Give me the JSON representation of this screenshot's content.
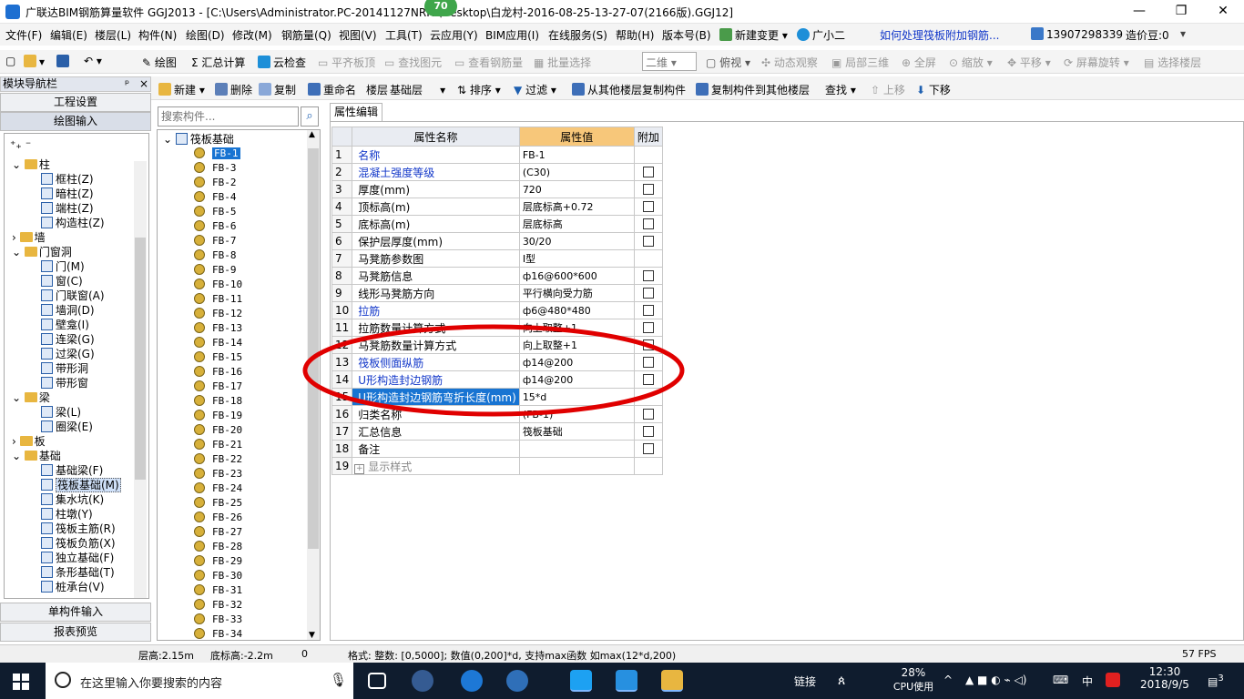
{
  "window": {
    "title": "广联达BIM钢筋算量软件 GGJ2013 - [C:\\Users\\Administrator.PC-20141127NRHI\\Desktop\\白龙村-2016-08-25-13-27-07(2166版).GGJ12]",
    "badge": "70",
    "minimize": "—",
    "restore": "❐",
    "close": "✕"
  },
  "menu": [
    "文件(F)",
    "编辑(E)",
    "楼层(L)",
    "构件(N)",
    "绘图(D)",
    "修改(M)",
    "钢筋量(Q)",
    "视图(V)",
    "工具(T)",
    "云应用(Y)",
    "BIM应用(I)",
    "在线服务(S)",
    "帮助(H)",
    "版本号(B)",
    "新建变更",
    "广小二",
    "如何处理筏板附加钢筋...",
    "13907298339",
    "造价豆:0"
  ],
  "toolbar1": {
    "draw": "绘图",
    "sum": "汇总计算",
    "cloud_check": "云检查",
    "align_board": "平齐板顶",
    "find_elem": "查找图元",
    "view_rebar": "查看钢筋量",
    "batch_select": "批量选择",
    "view_mode": "二维",
    "top_view": "俯视",
    "dyn_view": "动态观察",
    "local_3d": "局部三维",
    "fullscreen": "全屏",
    "zoom": "缩放",
    "pan": "平移",
    "rotate": "屏幕旋转",
    "select_floor": "选择楼层"
  },
  "nav": {
    "header": "模块导航栏",
    "pin": "ᵖ",
    "close": "×",
    "project_settings": "工程设置",
    "draw_input": "绘图输入",
    "single_input": "单构件输入",
    "report_preview": "报表预览",
    "tree": [
      {
        "label": "柱",
        "level": 0,
        "type": "folder",
        "exp": "⌄"
      },
      {
        "label": "框柱(Z)",
        "level": 1
      },
      {
        "label": "暗柱(Z)",
        "level": 1
      },
      {
        "label": "端柱(Z)",
        "level": 1
      },
      {
        "label": "构造柱(Z)",
        "level": 1
      },
      {
        "label": "墙",
        "level": 0,
        "type": "folder",
        "exp": "›"
      },
      {
        "label": "门窗洞",
        "level": 0,
        "type": "folder",
        "exp": "⌄"
      },
      {
        "label": "门(M)",
        "level": 1
      },
      {
        "label": "窗(C)",
        "level": 1
      },
      {
        "label": "门联窗(A)",
        "level": 1
      },
      {
        "label": "墙洞(D)",
        "level": 1
      },
      {
        "label": "壁龛(I)",
        "level": 1
      },
      {
        "label": "连梁(G)",
        "level": 1
      },
      {
        "label": "过梁(G)",
        "level": 1
      },
      {
        "label": "带形洞",
        "level": 1
      },
      {
        "label": "带形窗",
        "level": 1
      },
      {
        "label": "梁",
        "level": 0,
        "type": "folder",
        "exp": "⌄"
      },
      {
        "label": "梁(L)",
        "level": 1
      },
      {
        "label": "圈梁(E)",
        "level": 1
      },
      {
        "label": "板",
        "level": 0,
        "type": "folder",
        "exp": "›"
      },
      {
        "label": "基础",
        "level": 0,
        "type": "folder",
        "exp": "⌄"
      },
      {
        "label": "基础梁(F)",
        "level": 1
      },
      {
        "label": "筏板基础(M)",
        "level": 1,
        "selected": true
      },
      {
        "label": "集水坑(K)",
        "level": 1
      },
      {
        "label": "柱墩(Y)",
        "level": 1
      },
      {
        "label": "筏板主筋(R)",
        "level": 1
      },
      {
        "label": "筏板负筋(X)",
        "level": 1
      },
      {
        "label": "独立基础(F)",
        "level": 1
      },
      {
        "label": "条形基础(T)",
        "level": 1
      },
      {
        "label": "桩承台(V)",
        "level": 1
      }
    ]
  },
  "toolbar2": {
    "new": "新建",
    "delete": "删除",
    "copy": "复制",
    "rename": "重命名",
    "floor_label": "楼层",
    "floor_value": "基础层",
    "sort": "排序",
    "filter": "过滤",
    "copy_from": "从其他楼层复制构件",
    "copy_to": "复制构件到其他楼层",
    "find": "查找",
    "move_up": "上移",
    "move_down": "下移"
  },
  "search": {
    "placeholder": "搜索构件...",
    "icon": "⌕"
  },
  "component_tree": {
    "root": "筏板基础",
    "items": [
      "FB-1",
      "FB-3",
      "FB-2",
      "FB-4",
      "FB-5",
      "FB-6",
      "FB-7",
      "FB-8",
      "FB-9",
      "FB-10",
      "FB-11",
      "FB-12",
      "FB-13",
      "FB-14",
      "FB-15",
      "FB-16",
      "FB-17",
      "FB-18",
      "FB-19",
      "FB-20",
      "FB-21",
      "FB-22",
      "FB-23",
      "FB-24",
      "FB-25",
      "FB-26",
      "FB-27",
      "FB-28",
      "FB-29",
      "FB-30",
      "FB-31",
      "FB-32",
      "FB-33",
      "FB-34"
    ]
  },
  "props": {
    "tab": "属性编辑",
    "headers": [
      "属性名称",
      "属性值",
      "附加"
    ],
    "rows": [
      {
        "n": "1",
        "name": "名称",
        "value": "FB-1",
        "blue": true,
        "cb": false
      },
      {
        "n": "2",
        "name": "混凝土强度等级",
        "value": "(C30)",
        "blue": true,
        "cb": true
      },
      {
        "n": "3",
        "name": "厚度(mm)",
        "value": "720",
        "blue": false,
        "cb": true
      },
      {
        "n": "4",
        "name": "顶标高(m)",
        "value": "层底标高+0.72",
        "blue": false,
        "cb": true
      },
      {
        "n": "5",
        "name": "底标高(m)",
        "value": "层底标高",
        "blue": false,
        "cb": true
      },
      {
        "n": "6",
        "name": "保护层厚度(mm)",
        "value": "30/20",
        "blue": false,
        "cb": true
      },
      {
        "n": "7",
        "name": "马凳筋参数图",
        "value": "Ⅰ型",
        "blue": false,
        "cb": false
      },
      {
        "n": "8",
        "name": "马凳筋信息",
        "value": "ф16@600*600",
        "blue": false,
        "cb": true
      },
      {
        "n": "9",
        "name": "线形马凳筋方向",
        "value": "平行横向受力筋",
        "blue": false,
        "cb": true
      },
      {
        "n": "10",
        "name": "拉筋",
        "value": "ф6@480*480",
        "blue": true,
        "cb": true
      },
      {
        "n": "11",
        "name": "拉筋数量计算方式",
        "value": "向上取整+1",
        "blue": false,
        "cb": true
      },
      {
        "n": "12",
        "name": "马凳筋数量计算方式",
        "value": "向上取整+1",
        "blue": false,
        "cb": true
      },
      {
        "n": "13",
        "name": "筏板侧面纵筋",
        "value": "ф14@200",
        "blue": true,
        "cb": true
      },
      {
        "n": "14",
        "name": "U形构造封边钢筋",
        "value": "ф14@200",
        "blue": true,
        "cb": true
      },
      {
        "n": "15",
        "name": "U形构造封边钢筋弯折长度(mm)",
        "value": "15*d",
        "blue": false,
        "cb": false,
        "hl": true
      },
      {
        "n": "16",
        "name": "归类名称",
        "value": "(FB-1)",
        "blue": false,
        "cb": true
      },
      {
        "n": "17",
        "name": "汇总信息",
        "value": "筏板基础",
        "blue": false,
        "cb": true
      },
      {
        "n": "18",
        "name": "备注",
        "value": "",
        "blue": false,
        "cb": true
      },
      {
        "n": "19",
        "name": "显示样式",
        "value": "",
        "blue": false,
        "cb": false,
        "expander": "+"
      }
    ]
  },
  "status": {
    "floor_height": "层高:2.15m",
    "bottom_elev": "底标高:-2.2m",
    "zero": "0",
    "format": "格式: 整数: [0,5000]; 数值(0,200]*d, 支持max函数 如max(12*d,200)",
    "fps": "57 FPS"
  },
  "taskbar": {
    "search_text": "在这里输入你要搜索的内容",
    "link": "链接",
    "cpu_pct": "28%",
    "cpu_label": "CPU使用",
    "ime": "中",
    "time": "12:30",
    "date": "2018/9/5",
    "notif": "3"
  },
  "colors": {
    "accent": "#1874d2",
    "header_value": "#f7c77a",
    "annotation": "#e00000",
    "taskbar": "#0f1c2e"
  }
}
